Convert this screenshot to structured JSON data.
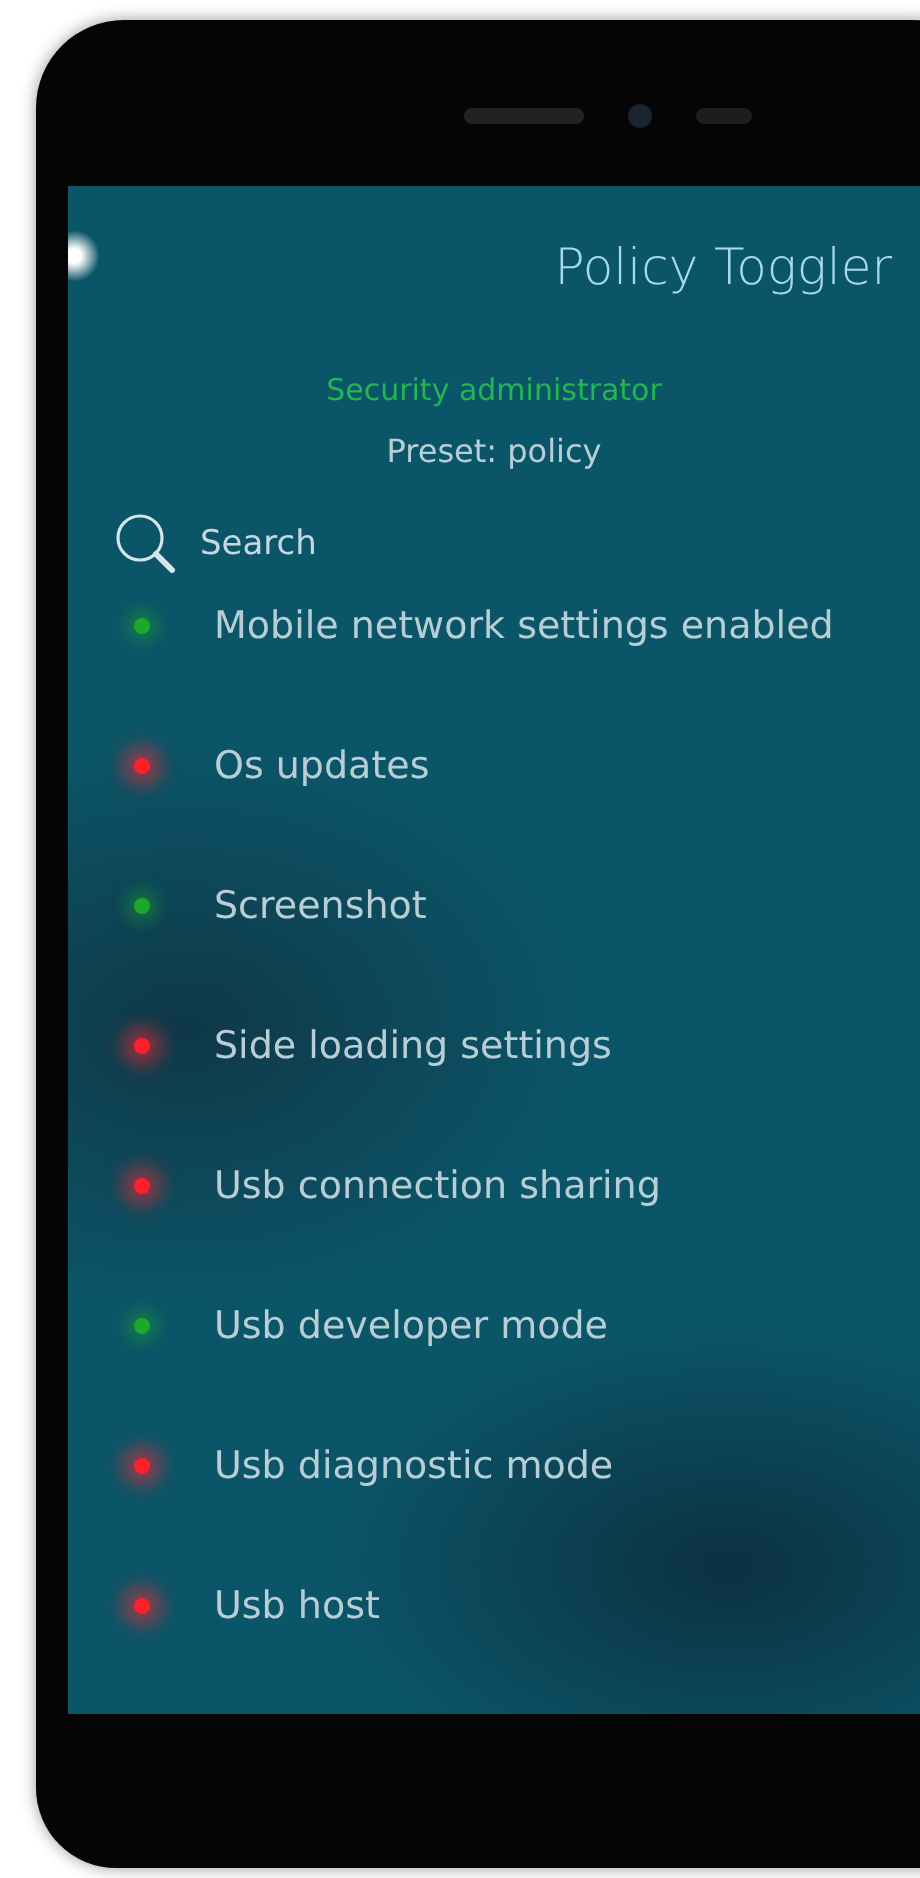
{
  "header": {
    "title": "Policy Toggler"
  },
  "subtitle": "Security administrator",
  "preset": "Preset: policy",
  "search": {
    "placeholder": "Search"
  },
  "policies": [
    {
      "label": "Mobile network settings enabled",
      "enabled": true
    },
    {
      "label": "Os updates",
      "enabled": false
    },
    {
      "label": "Screenshot",
      "enabled": true
    },
    {
      "label": "Side loading settings",
      "enabled": false
    },
    {
      "label": "Usb connection sharing",
      "enabled": false
    },
    {
      "label": "Usb developer mode",
      "enabled": true
    },
    {
      "label": "Usb diagnostic mode",
      "enabled": false
    },
    {
      "label": "Usb host",
      "enabled": false
    }
  ]
}
